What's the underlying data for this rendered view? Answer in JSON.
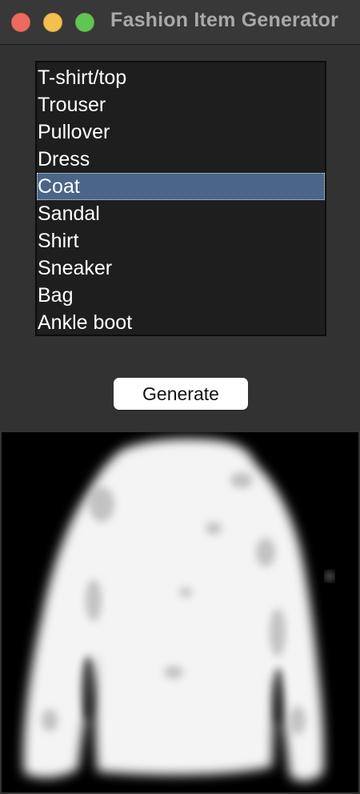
{
  "window": {
    "title": "Fashion Item Generator"
  },
  "listbox": {
    "items": [
      {
        "label": "T-shirt/top"
      },
      {
        "label": "Trouser"
      },
      {
        "label": "Pullover"
      },
      {
        "label": "Dress"
      },
      {
        "label": "Coat"
      },
      {
        "label": "Sandal"
      },
      {
        "label": "Shirt"
      },
      {
        "label": "Sneaker"
      },
      {
        "label": "Bag"
      },
      {
        "label": "Ankle boot"
      }
    ],
    "selected_label": "Coat"
  },
  "generate_button": {
    "label": "Generate"
  },
  "colors": {
    "window_bg": "#323232",
    "list_bg": "#1e1e1e",
    "selection": "#4a6587",
    "close": "#ed6a5e",
    "minimize": "#f5bf4f",
    "zoom": "#61c554"
  },
  "output_image": {
    "subject": "blurry white long-sleeve coat on black background"
  }
}
